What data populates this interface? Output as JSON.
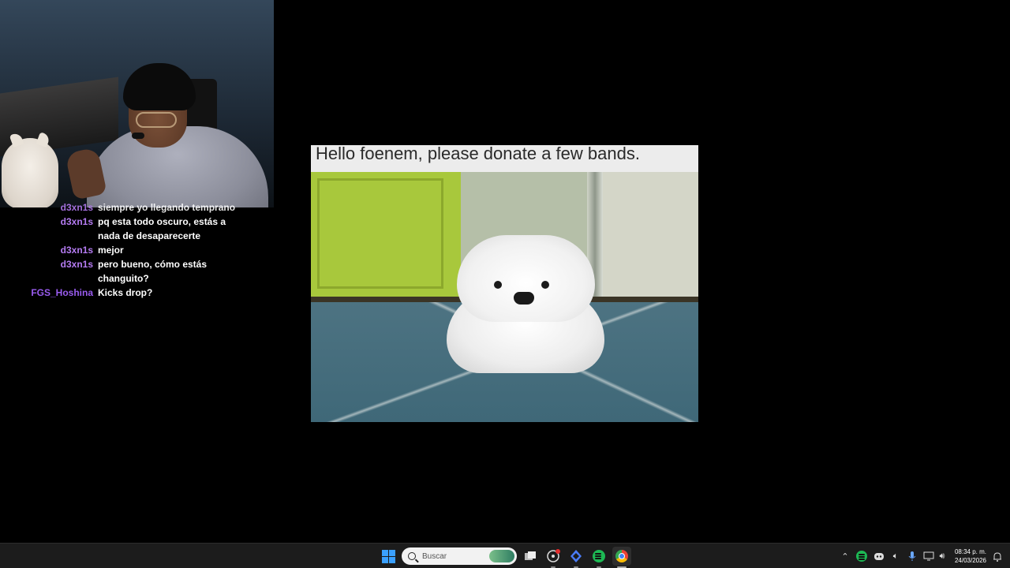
{
  "chat": {
    "messages": [
      {
        "user": "d3xn1s",
        "text": "siempre yo llegando temprano",
        "color": "#b57cf3"
      },
      {
        "user": "d3xn1s",
        "text": "pq esta todo oscuro, estás a nada de desaparecerte",
        "color": "#b57cf3"
      },
      {
        "user": "d3xn1s",
        "text": "mejor",
        "color": "#b57cf3"
      },
      {
        "user": "d3xn1s",
        "text": "pero bueno, cómo estás changuito?",
        "color": "#b57cf3"
      },
      {
        "user": "FGS_Hoshina",
        "text": "Kicks drop?",
        "color": "#9a5cf0"
      }
    ]
  },
  "meme": {
    "caption": "Hello foenem, please donate a few bands."
  },
  "taskbar": {
    "search_placeholder": "Buscar",
    "time": "08:34 p. m.",
    "date": "24/03/2026",
    "accent": "#3aa0ff"
  }
}
